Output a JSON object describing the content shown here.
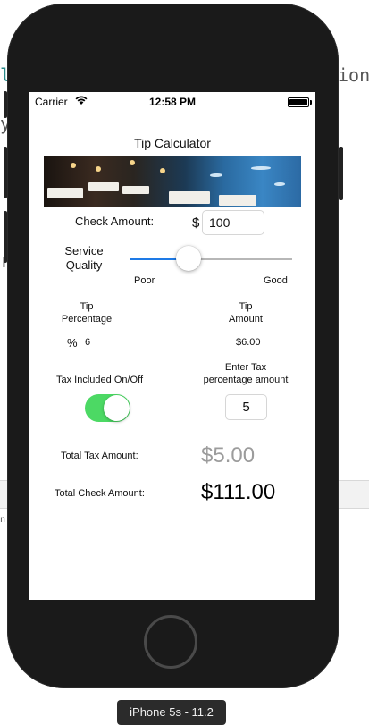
{
  "background": {
    "fragment_right": "ion",
    "fragment_left_top": "l",
    "fragment_left_mid": "y",
    "fragment_left_low": "r",
    "fragment_left_small": "n"
  },
  "device": {
    "label": "iPhone 5s - 11.2"
  },
  "status_bar": {
    "carrier": "Carrier",
    "time": "12:58 PM"
  },
  "app": {
    "title": "Tip Calculator",
    "check_amount_label": "Check Amount:",
    "currency_symbol": "$",
    "check_amount_value": "100",
    "service_quality_label_line1": "Service",
    "service_quality_label_line2": "Quality",
    "slider": {
      "min_label": "Poor",
      "max_label": "Good",
      "value_fraction": 0.36
    },
    "tip_percentage_label_line1": "Tip",
    "tip_percentage_label_line2": "Percentage",
    "tip_amount_label_line1": "Tip",
    "tip_amount_label_line2": "Amount",
    "percent_symbol": "%",
    "tip_percentage_value": "6",
    "tip_amount_value": "$6.00",
    "tax_toggle_label": "Tax Included On/Off",
    "tax_toggle_on": true,
    "enter_tax_label_line1": "Enter Tax",
    "enter_tax_label_line2": "percentage amount",
    "tax_percentage_value": "5",
    "total_tax_label": "Total Tax Amount:",
    "total_tax_value": "$5.00",
    "total_check_label": "Total Check Amount:",
    "total_check_value": "$111.00"
  },
  "colors": {
    "toggle_on": "#4cd964",
    "slider_active": "#1e7ae6",
    "device_body": "#1a1a1a"
  }
}
